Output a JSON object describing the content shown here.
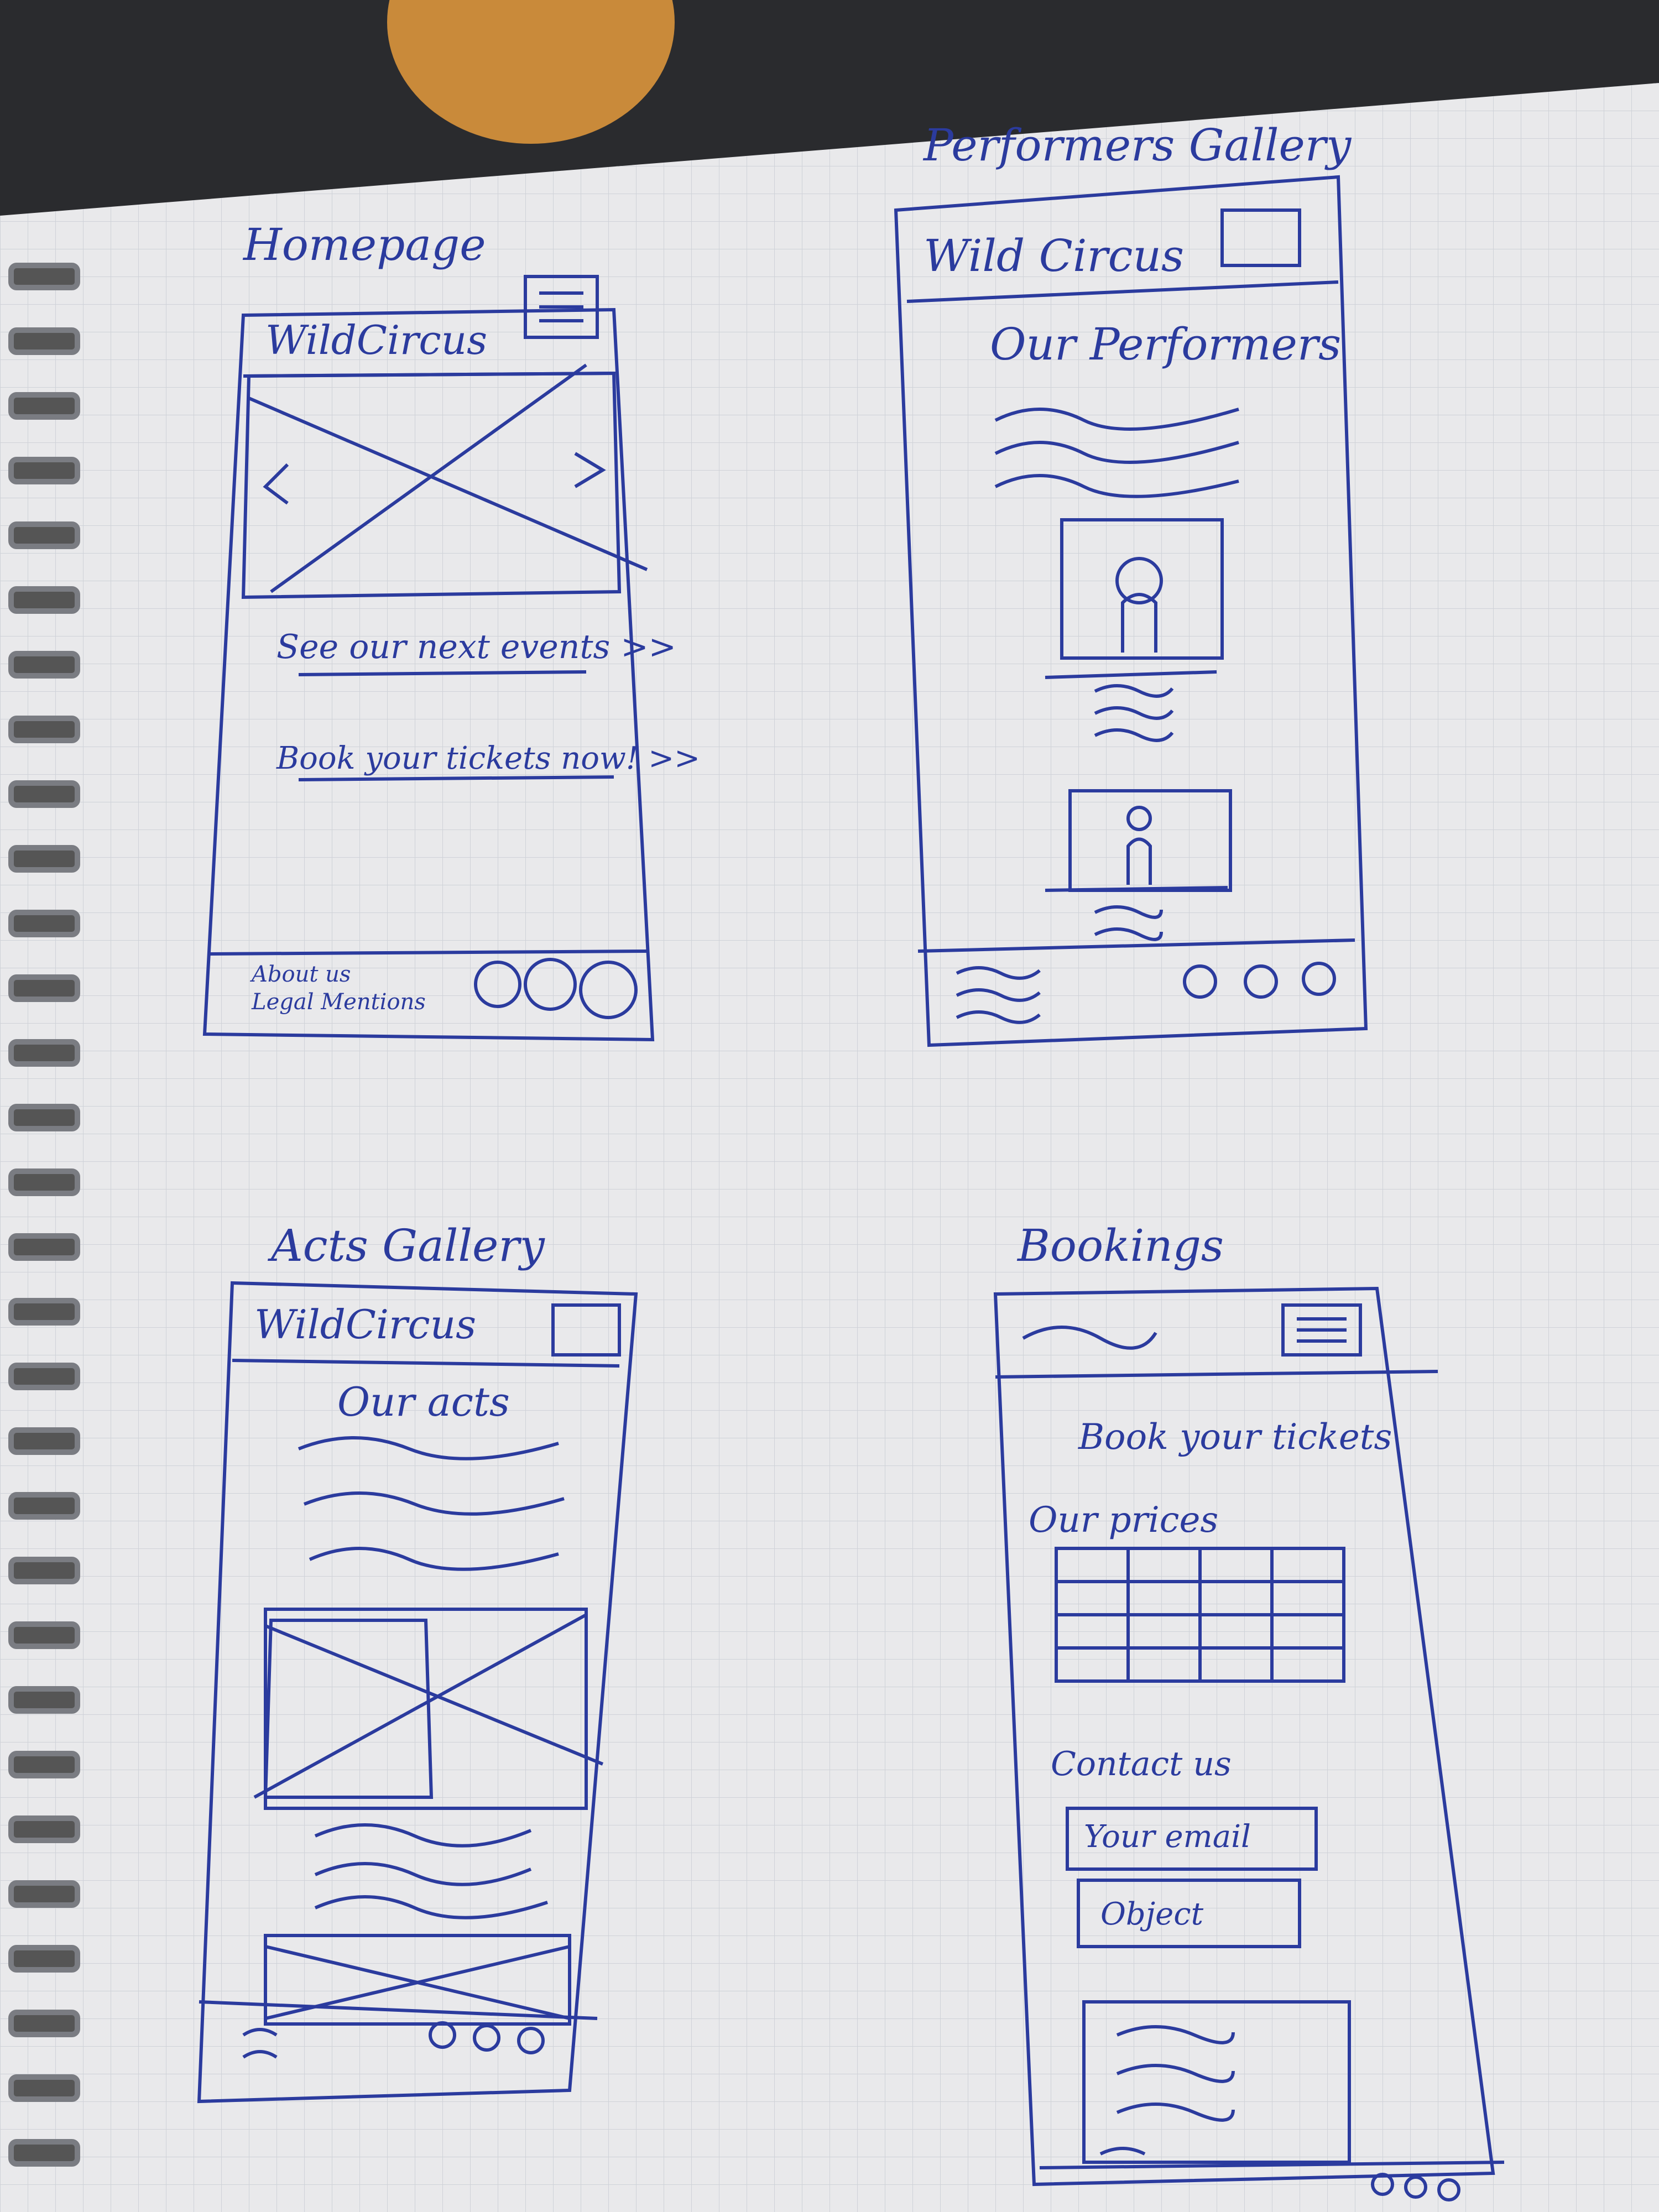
{
  "sheets": [
    {
      "heading": "Homepage",
      "brand": "WildCircus",
      "links": [
        "See our next events >>",
        "Book your tickets now! >>"
      ],
      "footer_links": [
        "About us",
        "Legal Mentions"
      ]
    },
    {
      "heading": "Performers Gallery",
      "brand": "Wild Circus",
      "page_title": "Our Performers"
    },
    {
      "heading": "Acts Gallery",
      "brand": "WildCircus",
      "page_title": "Our acts"
    },
    {
      "heading": "Bookings",
      "page_title": "Book your tickets",
      "prices_label": "Our prices",
      "contact_label": "Contact us",
      "email_placeholder": "Your email",
      "object_placeholder": "Object"
    }
  ],
  "colors": {
    "ink": "#2b3b9e",
    "paper": "#e9e9eb",
    "grid": "#cfd2d8",
    "background": "#2a2b2e"
  }
}
